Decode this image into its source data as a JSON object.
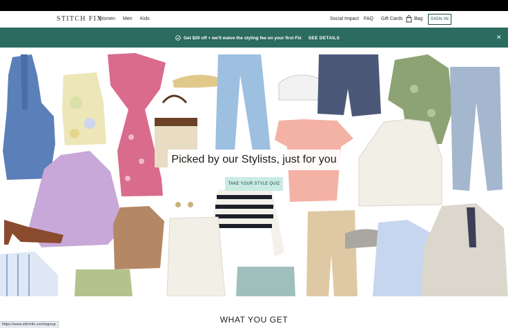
{
  "nav": {
    "logo": "STITCH FIX",
    "links_left": [
      "Women",
      "Men",
      "Kids"
    ],
    "links_right": [
      "Social Impact",
      "FAQ",
      "Gift Cards"
    ],
    "bag_label": "Bag",
    "signin_label": "SIGN IN"
  },
  "promo": {
    "text": "Get $20 off + we'll waive the styling fee on your first Fix",
    "link": "SEE DETAILS"
  },
  "hero": {
    "heading": "Picked by our Stylists, just for you",
    "cta_label": "TAKE YOUR STYLE QUIZ"
  },
  "section": {
    "title": "WHAT YOU GET"
  },
  "status_bar": {
    "url": "https://www.stitchfix.com/signup"
  },
  "colors": {
    "promo_bg": "#2c6b5f",
    "cta_bg": "#c8ece4",
    "signin_border": "#1a4c4c"
  }
}
